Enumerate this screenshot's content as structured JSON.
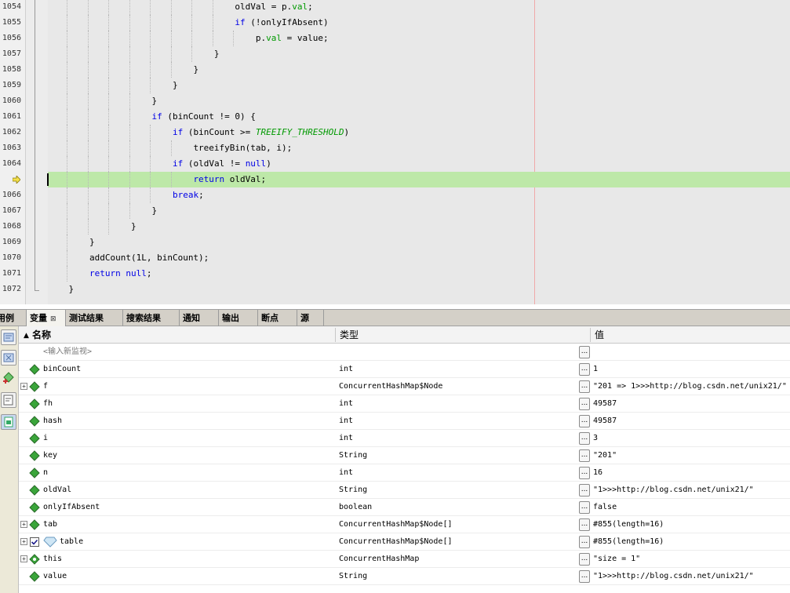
{
  "editor": {
    "lines": [
      {
        "num": "1054",
        "indent": 9,
        "tokens": [
          {
            "t": "oldVal = p."
          },
          {
            "t": "val",
            "c": "fld"
          },
          {
            "t": ";"
          }
        ]
      },
      {
        "num": "1055",
        "indent": 9,
        "tokens": [
          {
            "t": "if",
            "c": "kw"
          },
          {
            "t": " (!onlyIfAbsent)"
          }
        ]
      },
      {
        "num": "1056",
        "indent": 10,
        "tokens": [
          {
            "t": "p."
          },
          {
            "t": "val",
            "c": "fld"
          },
          {
            "t": " = value;"
          }
        ]
      },
      {
        "num": "1057",
        "indent": 8,
        "tokens": [
          {
            "t": "}"
          }
        ]
      },
      {
        "num": "1058",
        "indent": 7,
        "tokens": [
          {
            "t": "}"
          }
        ]
      },
      {
        "num": "1059",
        "indent": 6,
        "tokens": [
          {
            "t": "}"
          }
        ]
      },
      {
        "num": "1060",
        "indent": 5,
        "tokens": [
          {
            "t": "}"
          }
        ]
      },
      {
        "num": "1061",
        "indent": 5,
        "tokens": [
          {
            "t": "if",
            "c": "kw"
          },
          {
            "t": " (binCount != 0) {"
          }
        ]
      },
      {
        "num": "1062",
        "indent": 6,
        "tokens": [
          {
            "t": "if",
            "c": "kw"
          },
          {
            "t": " (binCount >= "
          },
          {
            "t": "TREEIFY_THRESHOLD",
            "c": "const"
          },
          {
            "t": ")"
          }
        ]
      },
      {
        "num": "1063",
        "indent": 7,
        "tokens": [
          {
            "t": "treeifyBin(tab, i);"
          }
        ]
      },
      {
        "num": "1064",
        "indent": 6,
        "tokens": [
          {
            "t": "if",
            "c": "kw"
          },
          {
            "t": " (oldVal != "
          },
          {
            "t": "null",
            "c": "kw"
          },
          {
            "t": ")"
          }
        ]
      },
      {
        "num": "",
        "indent": 7,
        "current": true,
        "tokens": [
          {
            "t": "return",
            "c": "kw"
          },
          {
            "t": " oldVal;"
          }
        ]
      },
      {
        "num": "1066",
        "indent": 6,
        "tokens": [
          {
            "t": "break",
            "c": "kw"
          },
          {
            "t": ";"
          }
        ]
      },
      {
        "num": "1067",
        "indent": 5,
        "tokens": [
          {
            "t": "}"
          }
        ]
      },
      {
        "num": "1068",
        "indent": 4,
        "tokens": [
          {
            "t": "}"
          }
        ]
      },
      {
        "num": "1069",
        "indent": 2,
        "tokens": [
          {
            "t": "}"
          }
        ]
      },
      {
        "num": "1070",
        "indent": 2,
        "tokens": [
          {
            "t": "addCount(1L, binCount);"
          }
        ]
      },
      {
        "num": "1071",
        "indent": 2,
        "tokens": [
          {
            "t": "return",
            "c": "kw"
          },
          {
            "t": " "
          },
          {
            "t": "null",
            "c": "kw"
          },
          {
            "t": ";"
          }
        ]
      },
      {
        "num": "1072",
        "indent": 1,
        "tokens": [
          {
            "t": "}"
          }
        ]
      }
    ]
  },
  "tabs": [
    {
      "label": "用例"
    },
    {
      "label": "变量",
      "active": true,
      "close": "⊠"
    },
    {
      "label": "测试结果"
    },
    {
      "label": "搜索结果"
    },
    {
      "label": "通知"
    },
    {
      "label": "输出"
    },
    {
      "label": "断点"
    },
    {
      "label": "源"
    }
  ],
  "variables": {
    "columns": {
      "name": "名称",
      "type": "类型",
      "value": "值"
    },
    "sort_indicator": "▲",
    "watch_placeholder": "<输入新监视>",
    "rows": [
      {
        "name": "binCount",
        "type": "int",
        "value": "1",
        "expandable": false
      },
      {
        "name": "f",
        "type": "ConcurrentHashMap$Node",
        "value": "\"201 => 1>>>http://blog.csdn.net/unix21/\"",
        "expandable": true
      },
      {
        "name": "fh",
        "type": "int",
        "value": "49587",
        "expandable": false
      },
      {
        "name": "hash",
        "type": "int",
        "value": "49587",
        "expandable": false
      },
      {
        "name": "i",
        "type": "int",
        "value": "3",
        "expandable": false
      },
      {
        "name": "key",
        "type": "String",
        "value": "\"201\"",
        "expandable": false
      },
      {
        "name": "n",
        "type": "int",
        "value": "16",
        "expandable": false
      },
      {
        "name": "oldVal",
        "type": "String",
        "value": "\"1>>>http://blog.csdn.net/unix21/\"",
        "expandable": false
      },
      {
        "name": "onlyIfAbsent",
        "type": "boolean",
        "value": "false",
        "expandable": false
      },
      {
        "name": "tab",
        "type": "ConcurrentHashMap$Node[]",
        "value": "#855(length=16)",
        "expandable": true
      },
      {
        "name": "table",
        "type": "ConcurrentHashMap$Node[]",
        "value": "#855(length=16)",
        "expandable": true,
        "static": true,
        "checked": true
      },
      {
        "name": "this",
        "type": "ConcurrentHashMap",
        "value": "\"size = 1\"",
        "expandable": true
      },
      {
        "name": "value",
        "type": "String",
        "value": "\"1>>>http://blog.csdn.net/unix21/\"",
        "expandable": false
      }
    ]
  },
  "colors": {
    "field_icon": "#3aa53a",
    "current_line": "#bde8a8",
    "keyword": "#0000e6"
  }
}
